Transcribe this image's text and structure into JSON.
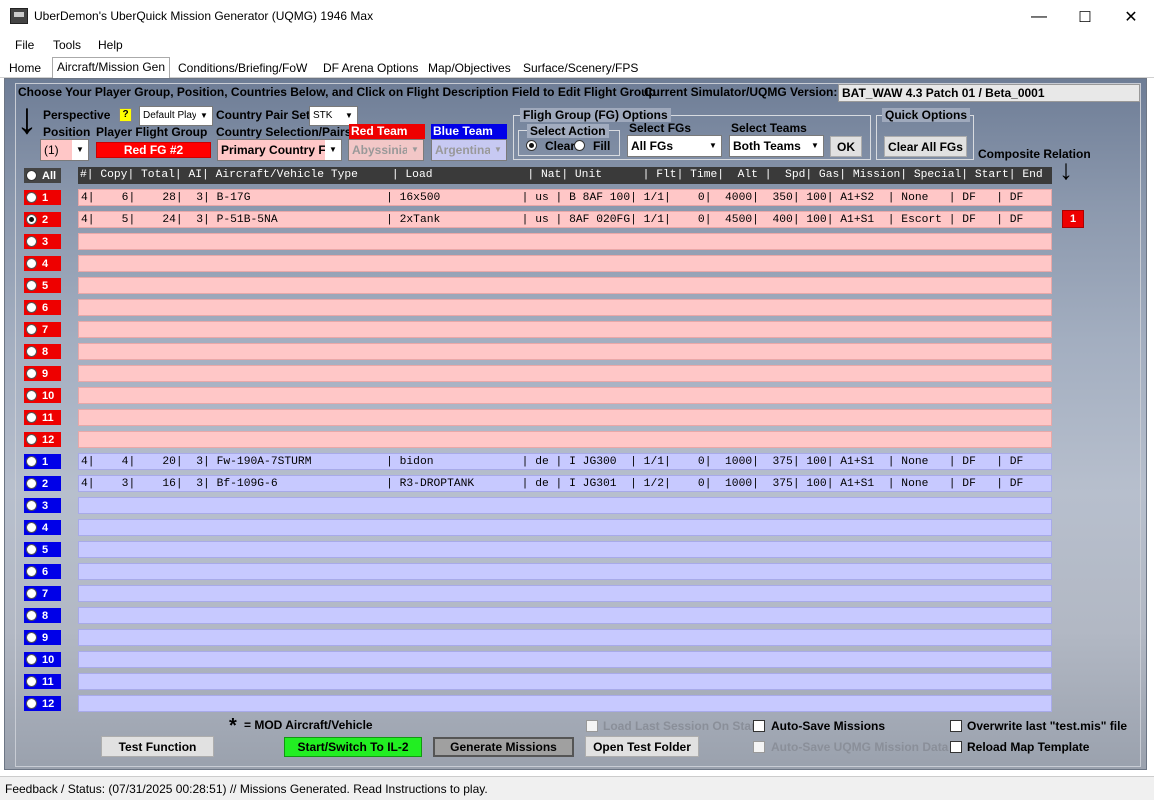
{
  "window": {
    "title": "UberDemon's UberQuick Mission Generator (UQMG) 1946 Max",
    "controls": {
      "minimize": "—",
      "maximize": "☐",
      "close": "✕"
    }
  },
  "menu": [
    "File",
    "Tools",
    "Help"
  ],
  "tabs": [
    {
      "label": "Home",
      "active": false
    },
    {
      "label": "Aircraft/Mission Gen",
      "active": true
    },
    {
      "label": "Conditions/Briefing/FoW",
      "active": false
    },
    {
      "label": "DF Arena Options",
      "active": false
    },
    {
      "label": "Map/Objectives",
      "active": false
    },
    {
      "label": "Surface/Scenery/FPS",
      "active": false
    }
  ],
  "instructions": "Choose Your Player Group, Position, Countries Below, and Click on Flight Description Field to Edit Flight Group",
  "version": {
    "label": "Current Simulator/UQMG Version:",
    "value": "BAT_WAW 4.3 Patch 01 / Beta_0001"
  },
  "controls": {
    "perspective_label": "Perspective",
    "help_badge": "?",
    "perspective_value": "Default Play",
    "country_pair_set_label": "Country Pair Set",
    "country_pair_set_value": "STK",
    "position_label": "Position",
    "position_value": "(1)",
    "player_fg_label": "Player Flight Group",
    "player_fg_value": "Red FG #2",
    "country_selection_label": "Country Selection/Pairs",
    "country_selection_value": "Primary Country F",
    "red_team_label": "Red Team",
    "blue_team_label": "Blue Team",
    "red_team_country": "Abyssinia",
    "blue_team_country": "Argentina"
  },
  "fg_options": {
    "title": "Fligh Group (FG) Options",
    "select_action_title": "Select Action",
    "clear_label": "Clear",
    "fill_label": "Fill",
    "select_fgs_label": "Select FGs",
    "select_fgs_value": "All FGs",
    "select_teams_label": "Select Teams",
    "select_teams_value": "Both Teams",
    "ok_label": "OK"
  },
  "quick_options": {
    "title": "Quick Options",
    "clear_all_label": "Clear All FGs"
  },
  "composite_relation": {
    "label": "Composite Relation",
    "badge": "1"
  },
  "arrows": {
    "down": "↓"
  },
  "table": {
    "all_label": "All",
    "header": "#| Copy| Total| AI| Aircraft/Vehicle Type     | Load              | Nat| Unit      | Flt| Time|  Alt |  Spd| Gas| Mission| Special| Start| End",
    "red_rows": [
      {
        "num": "1",
        "text": "4|    6|    28|  3| B-17G                    | 16x500            | us | B 8AF 100| 1/1|    0|  4000|  350| 100| A1+S2  | None   | DF   | DF"
      },
      {
        "num": "2",
        "text": "4|    5|    24|  3| P-51B-5NA                | 2xTank            | us | 8AF 020FG| 1/1|    0|  4500|  400| 100| A1+S1  | Escort | DF   | DF"
      },
      {
        "num": "3",
        "text": ""
      },
      {
        "num": "4",
        "text": ""
      },
      {
        "num": "5",
        "text": ""
      },
      {
        "num": "6",
        "text": ""
      },
      {
        "num": "7",
        "text": ""
      },
      {
        "num": "8",
        "text": ""
      },
      {
        "num": "9",
        "text": ""
      },
      {
        "num": "10",
        "text": ""
      },
      {
        "num": "11",
        "text": ""
      },
      {
        "num": "12",
        "text": ""
      }
    ],
    "blue_rows": [
      {
        "num": "1",
        "text": "4|    4|    20|  3| Fw-190A-7STURM           | bidon             | de | I JG300  | 1/1|    0|  1000|  375| 100| A1+S1  | None   | DF   | DF"
      },
      {
        "num": "2",
        "text": "4|    3|    16|  3| Bf-109G-6                | R3-DROPTANK       | de | I JG301  | 1/2|    0|  1000|  375| 100| A1+S1  | None   | DF   | DF"
      },
      {
        "num": "3",
        "text": ""
      },
      {
        "num": "4",
        "text": ""
      },
      {
        "num": "5",
        "text": ""
      },
      {
        "num": "6",
        "text": ""
      },
      {
        "num": "7",
        "text": ""
      },
      {
        "num": "8",
        "text": ""
      },
      {
        "num": "9",
        "text": ""
      },
      {
        "num": "10",
        "text": ""
      },
      {
        "num": "11",
        "text": ""
      },
      {
        "num": "12",
        "text": ""
      }
    ],
    "selected_red_row": "2"
  },
  "footer": {
    "mod_note": "= MOD Aircraft/Vehicle",
    "mod_star": "*",
    "test_function": "Test Function",
    "start_switch": "Start/Switch To IL-2",
    "generate": "Generate Missions",
    "open_test_folder": "Open Test Folder",
    "load_last_session": "Load Last Session On Start",
    "auto_save_missions": "Auto-Save Missions",
    "auto_save_uqmg": "Auto-Save UQMG Mission Data",
    "overwrite_test": "Overwrite last \"test.mis\" file",
    "reload_map": "Reload Map Template"
  },
  "status": "Feedback / Status:  (07/31/2025 00:28:51) // Missions Generated.  Read Instructions to play.",
  "colors": {
    "red_team": "#ee0000",
    "blue_team": "#0000e8",
    "red_row": "#ffc7c7",
    "blue_row": "#c7c9ff",
    "start_button": "#22ee22"
  }
}
